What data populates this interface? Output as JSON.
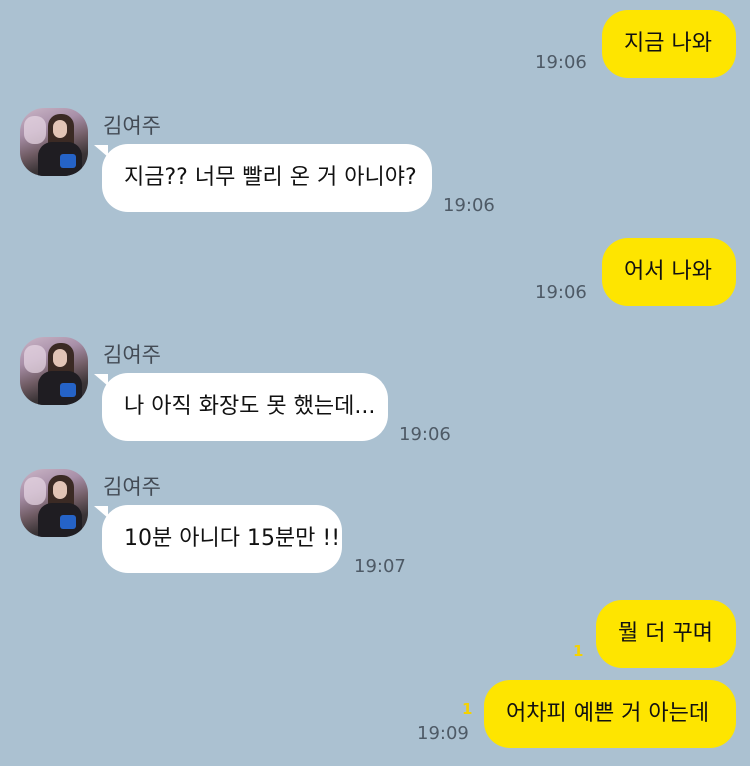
{
  "contact": {
    "name": "김여주"
  },
  "messages": [
    {
      "sender": "me",
      "text": "지금 나와",
      "time": "19:06",
      "unread": ""
    },
    {
      "sender": "them",
      "text": "지금?? 너무 빨리 온 거 아니야?",
      "time": "19:06"
    },
    {
      "sender": "me",
      "text": "어서 나와",
      "time": "19:06",
      "unread": ""
    },
    {
      "sender": "them",
      "text": "나 아직 화장도 못 했는데...",
      "time": "19:06"
    },
    {
      "sender": "them",
      "text": "10분 아니다 15분만 !!",
      "time": "19:07"
    },
    {
      "sender": "me",
      "text": "뭘 더 꾸며",
      "time": "",
      "unread": "1"
    },
    {
      "sender": "me",
      "text": "어차피 예쁜 거 아는데",
      "time": "19:09",
      "unread": "1"
    }
  ],
  "colors": {
    "background": "#abc1d1",
    "my_bubble": "#fee500",
    "their_bubble": "#ffffff",
    "unread": "#f5d200"
  }
}
